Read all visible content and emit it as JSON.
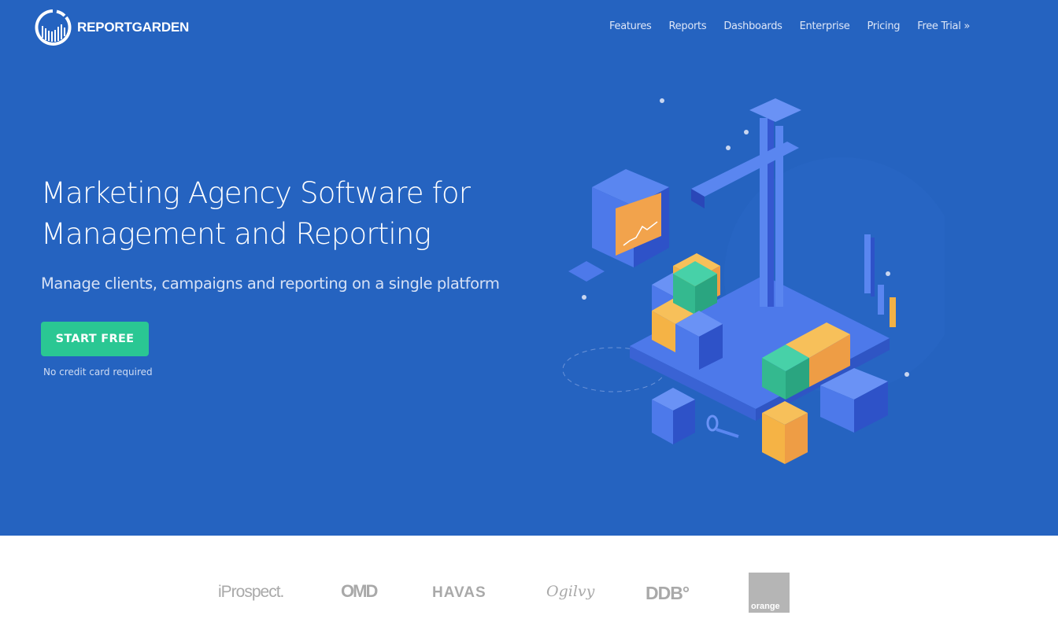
{
  "brand": {
    "name": "REPORTGARDEN"
  },
  "nav": {
    "items": [
      {
        "label": "Features"
      },
      {
        "label": "Reports"
      },
      {
        "label": "Dashboards"
      },
      {
        "label": "Enterprise"
      },
      {
        "label": "Pricing"
      },
      {
        "label": "Free Trial »"
      }
    ]
  },
  "hero": {
    "headline_line1": "Marketing Agency Software for",
    "headline_line2": "Management and Reporting",
    "subheadline": "Manage clients, campaigns and reporting on a single platform",
    "cta_label": "START FREE",
    "cta_note": "No credit card required",
    "colors": {
      "background": "#2563c0",
      "cta": "#2ac793"
    }
  },
  "clients": {
    "logos": [
      {
        "name": "iProspect."
      },
      {
        "name": "OMD"
      },
      {
        "name": "HAVAS"
      },
      {
        "name": "Ogilvy"
      },
      {
        "name": "DDB°"
      },
      {
        "name": "orange"
      }
    ]
  }
}
